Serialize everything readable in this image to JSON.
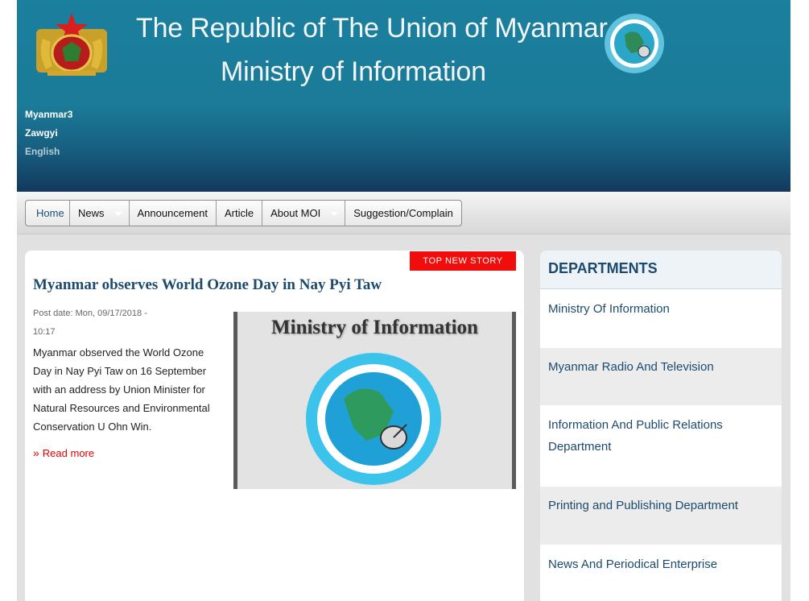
{
  "header": {
    "title_line1": "The Republic of The Union of Myanmar",
    "title_line2": "Ministry of Information",
    "languages": [
      "Myanmar3",
      "Zawgyi",
      "English"
    ]
  },
  "nav": {
    "items": [
      {
        "label": "Home",
        "dropdown": false
      },
      {
        "label": "News",
        "dropdown": true
      },
      {
        "label": "Announcement",
        "dropdown": false
      },
      {
        "label": "Article",
        "dropdown": false
      },
      {
        "label": "About MOI",
        "dropdown": true
      },
      {
        "label": "Suggestion/Complain",
        "dropdown": false
      }
    ]
  },
  "story": {
    "badge": "TOP NEW STORY",
    "title": "Myanmar observes World Ozone Day in Nay Pyi Taw",
    "post_date": "Post date: Mon, 09/17/2018 - 10:17",
    "body": "Myanmar observed the World Ozone Day in Nay Pyi Taw on 16 September with an address by Union Minister for Natural Resources and Environmental Conservation U Ohn Win.",
    "read_more": "Read more",
    "image_caption": "Ministry of Information"
  },
  "departments": {
    "title": "DEPARTMENTS",
    "items": [
      "Ministry Of Information",
      "Myanmar Radio And Television",
      "Information And Public Relations Department",
      "Printing and Publishing Department",
      "News And Periodical Enterprise"
    ]
  },
  "colors": {
    "header_top": "#1b7f9e",
    "header_bottom": "#12395d",
    "link_blue": "#1c4a6e",
    "badge_red": "#f20d0d",
    "read_more_red": "#e60000"
  },
  "icons": {
    "emblem": "state-emblem-icon",
    "seal": "ministry-seal-icon",
    "read_more": "double-chevron-right-icon",
    "dropdown": "caret-down-icon"
  }
}
